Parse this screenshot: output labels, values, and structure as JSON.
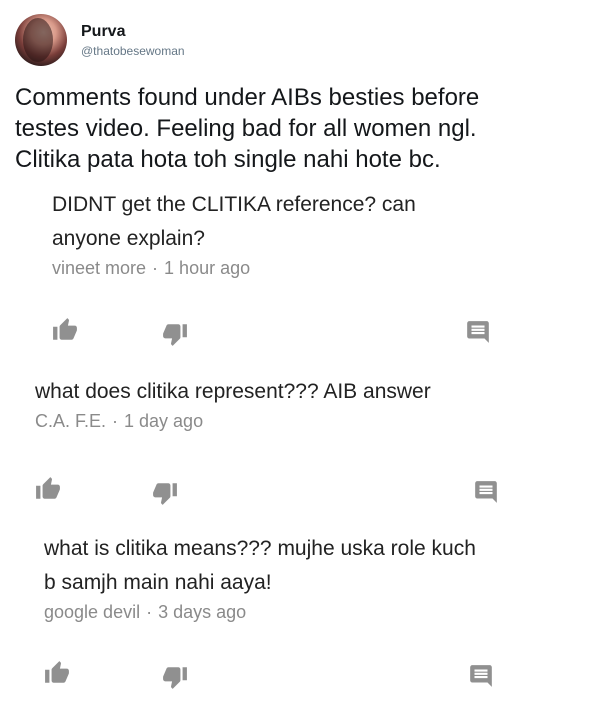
{
  "tweet": {
    "display_name": "Purva",
    "handle": "@thatobesewoman",
    "text_lines": [
      "Comments found under AIBs besties before",
      "testes video. Feeling bad for all women ngl.",
      "Clitika pata hota toh single nahi hote bc."
    ]
  },
  "comments": [
    {
      "text_lines": [
        "DIDNT get the CLITIKA reference? can",
        "anyone explain?"
      ],
      "author": "vineet more",
      "separator": "·",
      "time": "1 hour ago"
    },
    {
      "text_lines": [
        "what does clitika represent??? AIB answer"
      ],
      "author": "C.A. F.E.",
      "separator": "·",
      "time": "1 day ago"
    },
    {
      "text_lines": [
        "what is clitika means??? mujhe uska role kuch",
        "b samjh main nahi aaya!"
      ],
      "author": "google devil",
      "separator": "·",
      "time": "3 days ago"
    }
  ],
  "icons": {
    "like": "thumbs-up-icon",
    "dislike": "thumbs-down-icon",
    "reply": "reply-comment-icon"
  },
  "colors": {
    "icon": "#909090",
    "meta": "#8a8a8a",
    "handle": "#657786"
  }
}
